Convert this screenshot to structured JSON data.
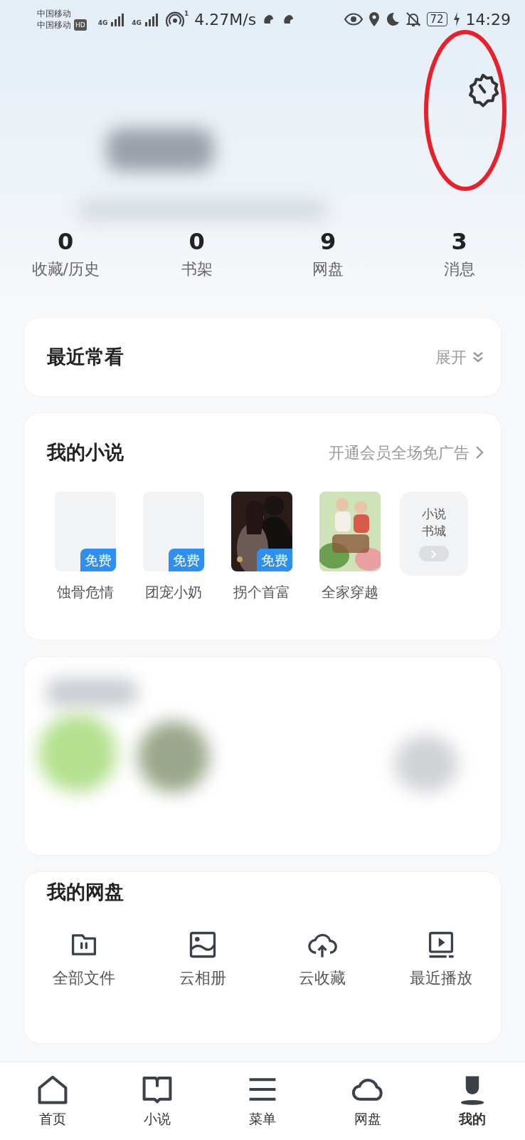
{
  "status_bar": {
    "carriers": [
      "中国移动",
      "中国移动"
    ],
    "hd": "HD",
    "network": [
      "4G",
      "4G"
    ],
    "hotspot_count": "1",
    "speed": "4.27M/s",
    "battery": "72",
    "time": "14:29"
  },
  "stats": [
    {
      "value": "0",
      "label": "收藏/历史"
    },
    {
      "value": "0",
      "label": "书架"
    },
    {
      "value": "9",
      "label": "网盘"
    },
    {
      "value": "3",
      "label": "消息"
    }
  ],
  "recent": {
    "title": "最近常看",
    "action": "展开"
  },
  "novels": {
    "title": "我的小说",
    "promo": "开通会员全场免广告",
    "books": [
      {
        "title": "蚀骨危情",
        "badge": "免费",
        "kind": "blank"
      },
      {
        "title": "团宠小奶",
        "badge": "免费",
        "kind": "blank"
      },
      {
        "title": "拐个首富",
        "badge": "免费",
        "kind": "picture"
      },
      {
        "title": "全家穿越",
        "kind": "picture"
      }
    ],
    "store": "小说书城"
  },
  "drive": {
    "title": "我的网盘",
    "items": [
      {
        "label": "全部文件"
      },
      {
        "label": "云相册"
      },
      {
        "label": "云收藏"
      },
      {
        "label": "最近播放"
      }
    ]
  },
  "nav": [
    {
      "label": "首页",
      "selected": false
    },
    {
      "label": "小说",
      "selected": false
    },
    {
      "label": "菜单",
      "selected": false
    },
    {
      "label": "网盘",
      "selected": false
    },
    {
      "label": "我的",
      "selected": true
    }
  ]
}
